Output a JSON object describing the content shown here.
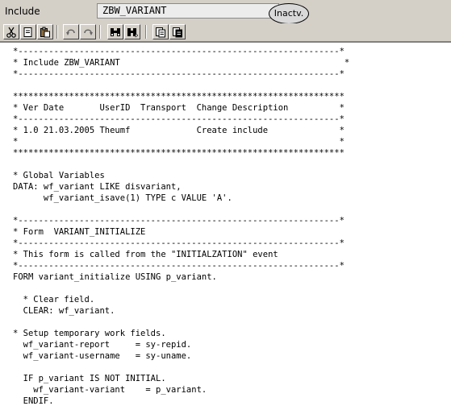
{
  "header": {
    "label": "Include",
    "program_name": "ZBW_VARIANT",
    "status": "Inactv."
  },
  "toolbar": {
    "buttons": [
      {
        "name": "cut-button",
        "icon": "scissors-icon"
      },
      {
        "name": "copy-button",
        "icon": "copy-icon"
      },
      {
        "name": "paste-button",
        "icon": "clipboard-icon"
      },
      {
        "name": "undo-button",
        "icon": "undo-icon"
      },
      {
        "name": "redo-button",
        "icon": "redo-icon"
      },
      {
        "name": "find-button",
        "icon": "binoculars-icon"
      },
      {
        "name": "find-next-button",
        "icon": "binoculars-next-icon"
      },
      {
        "name": "insert-pattern-button",
        "icon": "insert-icon"
      },
      {
        "name": "pretty-printer-button",
        "icon": "format-icon"
      }
    ]
  },
  "editor": {
    "lines": [
      "*---------------------------------------------------------------*",
      "* Include ZBW_VARIANT                                            *",
      "*---------------------------------------------------------------*",
      "",
      "*****************************************************************",
      "* Ver Date       UserID  Transport  Change Description          *",
      "*---------------------------------------------------------------*",
      "* 1.0 21.03.2005 Theumf             Create include              *",
      "*                                                               *",
      "*****************************************************************",
      "",
      "* Global Variables",
      "DATA: wf_variant LIKE disvariant,",
      "      wf_variant_isave(1) TYPE c VALUE 'A'.",
      "",
      "*---------------------------------------------------------------*",
      "* Form  VARIANT_INITIALIZE",
      "*---------------------------------------------------------------*",
      "* This form is called from the \"INITIALZATION\" event",
      "*---------------------------------------------------------------*",
      "FORM variant_initialize USING p_variant.",
      "",
      "  * Clear field.",
      "  CLEAR: wf_variant.",
      "",
      "* Setup temporary work fields.",
      "  wf_variant-report     = sy-repid.",
      "  wf_variant-username   = sy-uname.",
      "",
      "  IF p_variant IS NOT INITIAL.",
      "    wf_variant-variant    = p_variant.",
      "  ENDIF."
    ]
  }
}
